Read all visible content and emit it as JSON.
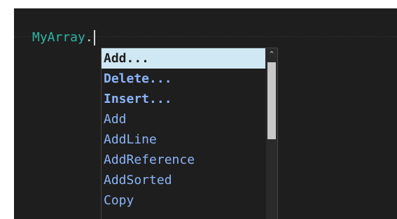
{
  "editor": {
    "identifier": "MyArray",
    "member_access": "."
  },
  "completion": {
    "items": [
      {
        "label": "Add...",
        "style": "bold",
        "selected": true
      },
      {
        "label": "Delete...",
        "style": "bold"
      },
      {
        "label": "Insert...",
        "style": "bold"
      },
      {
        "label": "Add"
      },
      {
        "label": "AddLine"
      },
      {
        "label": "AddReference"
      },
      {
        "label": "AddSorted"
      },
      {
        "label": "Copy"
      }
    ],
    "scroll_up_icon": "chevron-up-icon"
  },
  "colors": {
    "editor_background": "#1e1e1e",
    "identifier": "#2fb5a5",
    "item_text": "#8ab4f8",
    "selected_background": "#cfe8f3"
  }
}
